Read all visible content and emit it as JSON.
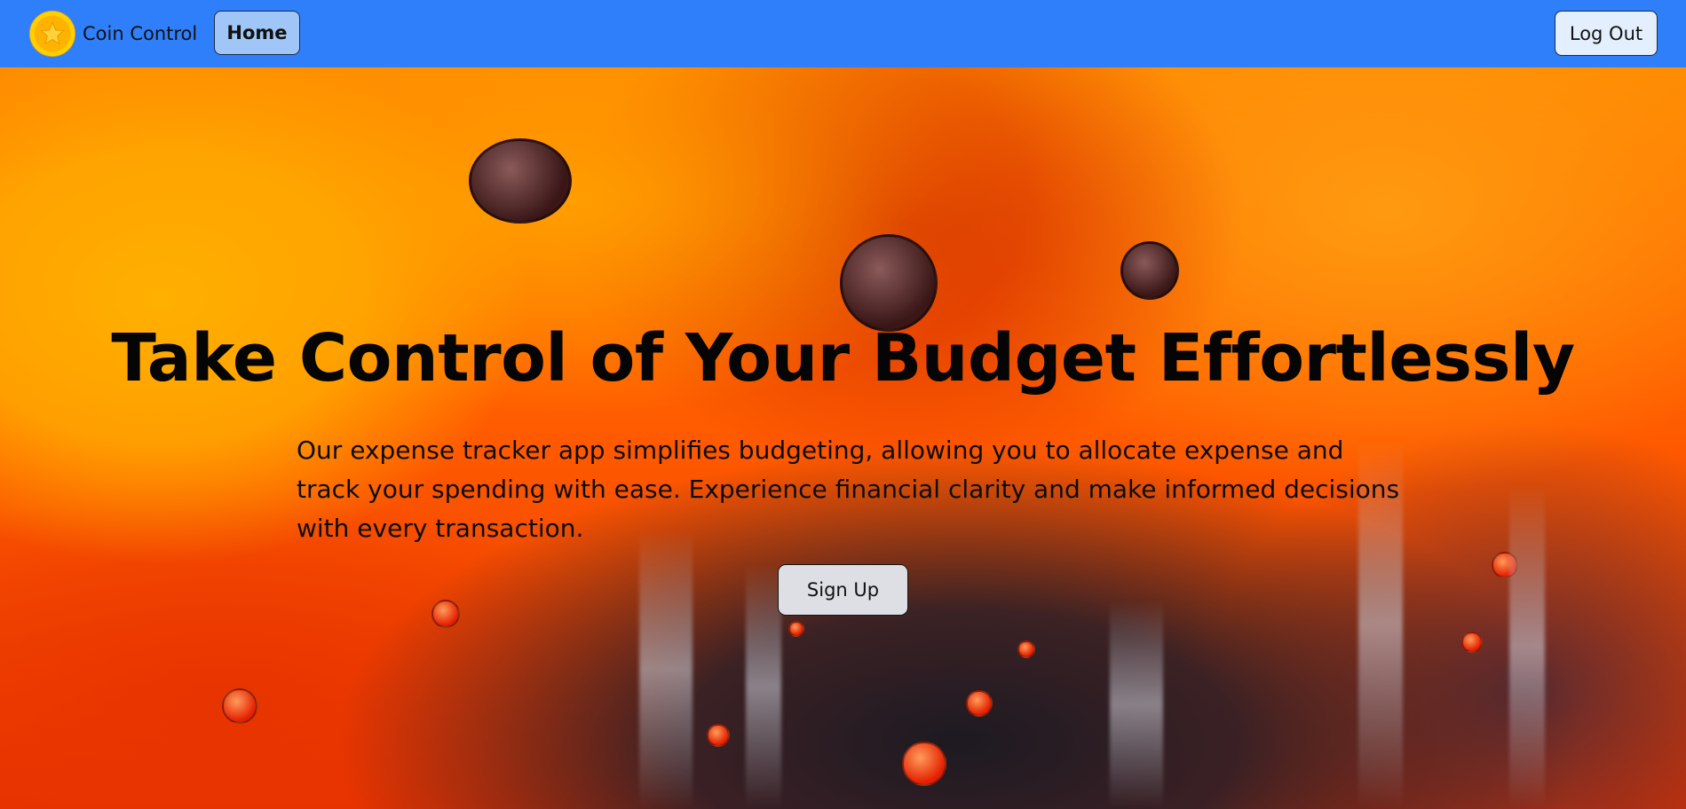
{
  "navbar": {
    "brand_name": "Coin Control",
    "home_label": "Home",
    "logout_label": "Log Out",
    "logo_icon": "star-coin-icon",
    "background_color": "#2f7ffb"
  },
  "hero": {
    "title": "Take Control of Your Budget Effortlessly",
    "description": "Our expense tracker app simplifies budgeting, allowing you to allocate expense and track your spending with ease. Experience financial clarity and make informed decisions with every transaction.",
    "signup_label": "Sign Up",
    "background": "abstract orange-red fluid art"
  }
}
